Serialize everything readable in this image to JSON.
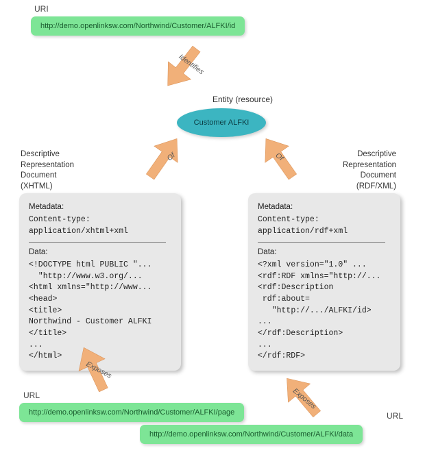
{
  "uri_top": {
    "label": "URI",
    "value": "http://demo.openlinksw.com/Northwind/Customer/ALFKI/id"
  },
  "entity": {
    "label": "Entity (resource)",
    "text": "Customer ALFKI"
  },
  "arrows": {
    "identifies": "Identifies",
    "of_left": "Of",
    "of_right": "Of",
    "exposes_left": "Exposes",
    "exposes_right": "Exposes"
  },
  "doc_left": {
    "label": "Descriptive\nRepresentation\nDocument\n(XHTML)",
    "metadata_heading": "Metadata:",
    "metadata_body": "Content-type:\napplication/xhtml+xml",
    "data_heading": "Data:",
    "data_body": "<!DOCTYPE html PUBLIC \"...\n  \"http://www.w3.org/...\n<html xmlns=\"http://www...\n<head>\n<title>\nNorthwind - Customer ALFKI\n</title>\n...\n</html>"
  },
  "doc_right": {
    "label": "Descriptive\nRepresentation\nDocument\n(RDF/XML)",
    "metadata_heading": "Metadata:",
    "metadata_body": "Content-type:\napplication/rdf+xml",
    "data_heading": "Data:",
    "data_body": "<?xml version=\"1.0\" ...\n<rdf:RDF xmlns=\"http://...\n<rdf:Description\n rdf:about=\n   \"http://.../ALFKI/id>\n...\n</rdf:Description>\n...\n</rdf:RDF>"
  },
  "url_left": {
    "label": "URL",
    "value": "http://demo.openlinksw.com/Northwind/Customer/ALFKI/page"
  },
  "url_right": {
    "label": "URL",
    "value": "http://demo.openlinksw.com/Northwind/Customer/ALFKI/data"
  }
}
